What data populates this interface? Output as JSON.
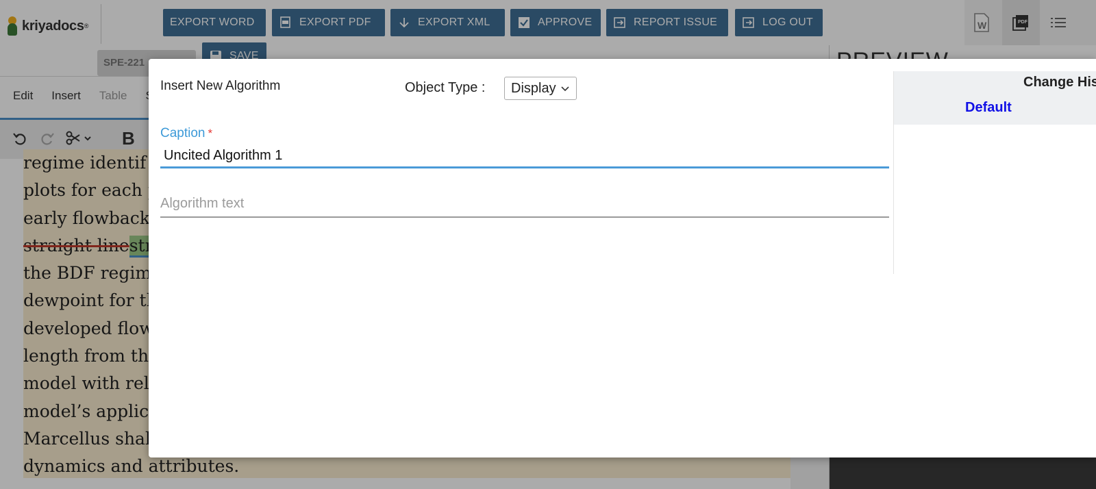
{
  "app": {
    "logo_text": "kriyadocs",
    "logo_mark": "®",
    "doc_id": "SPE-221"
  },
  "toolbar": {
    "export_word": "EXPORT WORD",
    "export_pdf": "EXPORT PDF",
    "export_xml": "EXPORT XML",
    "approve": "APPROVE",
    "report_issue": "REPORT ISSUE",
    "log_out": "LOG OUT",
    "save": "SAVE"
  },
  "menu": {
    "edit": "Edit",
    "insert": "Insert",
    "table": "Table",
    "s": "S"
  },
  "preview": {
    "title": "PREVIEW"
  },
  "document": {
    "lines": [
      "regime identif",
      "plots for each p",
      "early flowback",
      "the BDF regim",
      "dewpoint for th",
      "developed flow",
      "length from th",
      "model with rel",
      "model’s applic",
      "Marcellus shal",
      "dynamics and attributes."
    ],
    "deleted_text": "straight line",
    "inserted_text": "str"
  },
  "modal": {
    "title": "Insert New Algorithm",
    "object_type_label": "Object Type :",
    "object_type_value": "Display",
    "caption_label": "Caption",
    "caption_required": "*",
    "caption_value": "Uncited Algorithm 1",
    "algorithm_placeholder": "Algorithm text",
    "history_title": "Change His",
    "history_default": "Default"
  },
  "colors": {
    "toolbar_button": "#3f6f96",
    "caption_accent": "#3d9ad8",
    "required": "#e53935",
    "history_link": "#1010e6"
  }
}
